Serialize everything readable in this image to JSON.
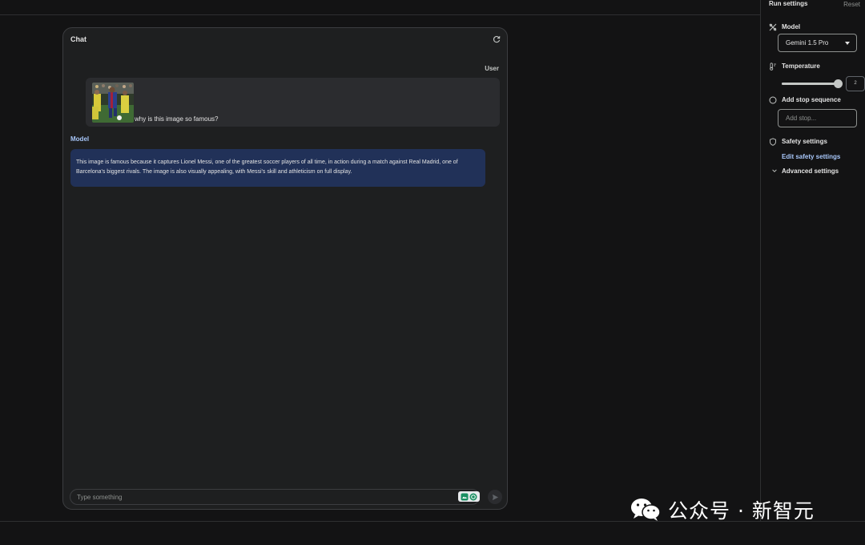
{
  "chat": {
    "title": "Chat",
    "user_role": "User",
    "user_message": "why is this image so famous?",
    "model_role": "Model",
    "model_message": "This image is famous because it captures Lionel Messi, one of the greatest soccer players of all time, in action during a match against Real Madrid, one of Barcelona's biggest rivals. The image is also visually appealing, with Messi's skill and athleticism on full display.",
    "input_placeholder": "Type something"
  },
  "settings": {
    "title": "Run settings",
    "reset_label": "Reset",
    "model_label": "Model",
    "model_value": "Gemini 1.5 Pro",
    "temperature_label": "Temperature",
    "temperature_value": "2",
    "temperature_fraction": 1.0,
    "stop_sequence_label": "Add stop sequence",
    "stop_placeholder": "Add stop...",
    "safety_label": "Safety settings",
    "edit_safety_label": "Edit safety settings",
    "advanced_label": "Advanced settings"
  },
  "watermark": {
    "text": "公众号 · 新智元"
  },
  "colors": {
    "background": "#131314",
    "panel": "#1e1f20",
    "user_bubble": "#2b2c2f",
    "model_bubble": "#213158",
    "accent": "#a8c7fa"
  }
}
